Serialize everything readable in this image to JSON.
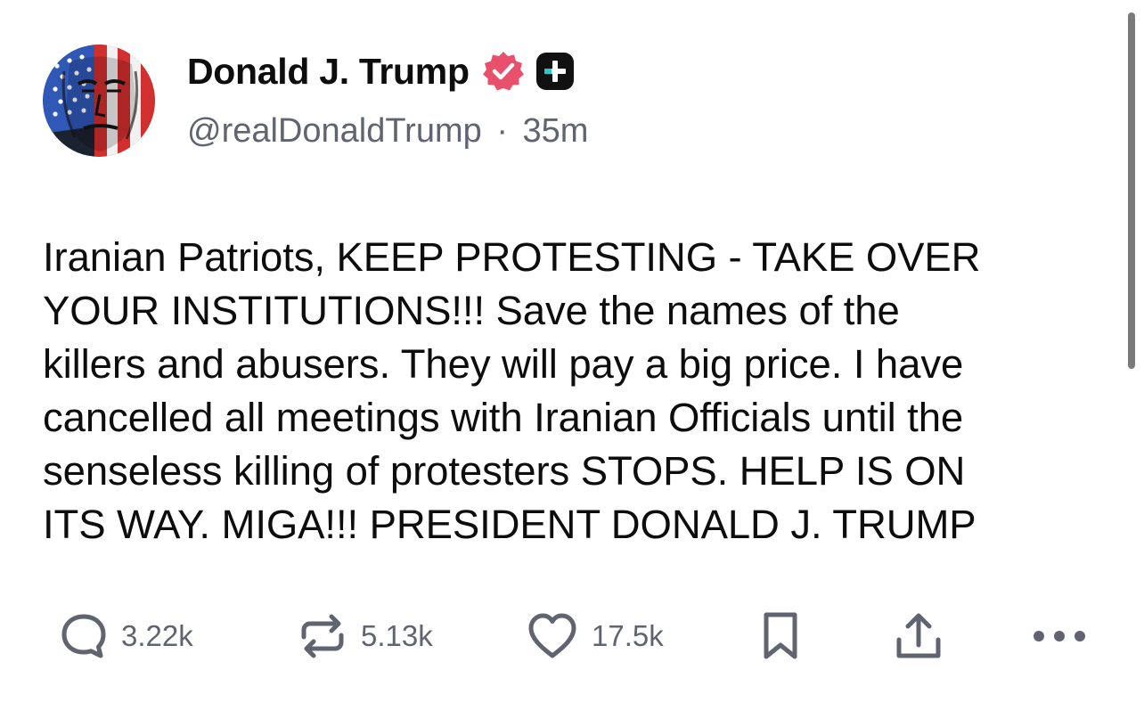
{
  "post": {
    "author": {
      "display_name": "Donald J. Trump",
      "handle": "@realDonaldTrump",
      "separator": "·",
      "time_ago": "35m"
    },
    "text": "Iranian Patriots, KEEP PROTESTING - TAKE OVER YOUR INSTITUTIONS!!! Save the names of the killers and abusers. They will pay a big price. I have cancelled all meetings with Iranian Officials until the senseless killing of protesters STOPS. HELP IS ON ITS WAY. MIGA!!! PRESIDENT DONALD J. TRUMP",
    "text_lines": [
      "Iranian Patriots, KEEP PROTESTING - TAKE OVER",
      "YOUR INSTITUTIONS!!! Save the names of the",
      "killers and abusers. They will pay a big price. I have",
      "cancelled all meetings with Iranian Officials until the",
      "senseless killing of protesters STOPS. HELP IS ON",
      "ITS WAY. MIGA!!! PRESIDENT DONALD J. TRUMP"
    ],
    "actions": {
      "reply_count": "3.22k",
      "repost_count": "5.13k",
      "like_count": "17.5k"
    }
  },
  "icons": {
    "avatar": "avatar-flag-portrait",
    "verified": "verified-badge-icon",
    "plus_badge": "plus-badge-icon",
    "reply": "speech-bubble-icon",
    "repost": "repost-arrows-icon",
    "like": "heart-icon",
    "bookmark": "bookmark-icon",
    "share": "share-upload-icon",
    "more": "ellipsis-icon"
  },
  "colors": {
    "text": "#0d0d0d",
    "muted": "#5f6470",
    "verified_badge": "#e8506b",
    "plus_badge": "#111111"
  }
}
